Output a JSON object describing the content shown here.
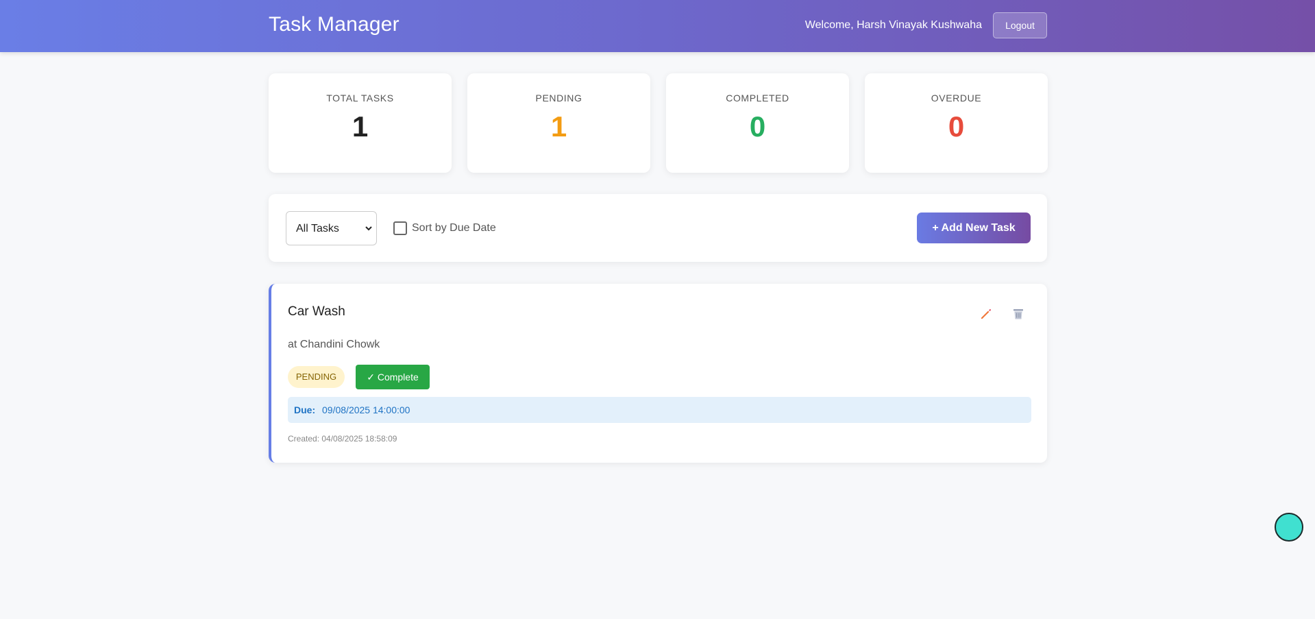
{
  "header": {
    "title": "Task Manager",
    "welcome": "Welcome, Harsh Vinayak Kushwaha",
    "logout_label": "Logout"
  },
  "stats": [
    {
      "label": "TOTAL TASKS",
      "value": "1",
      "color": "#222222"
    },
    {
      "label": "PENDING",
      "value": "1",
      "color": "#f39c12"
    },
    {
      "label": "COMPLETED",
      "value": "0",
      "color": "#27ae60"
    },
    {
      "label": "OVERDUE",
      "value": "0",
      "color": "#e74c3c"
    }
  ],
  "toolbar": {
    "filter_selected": "All Tasks",
    "sort_label": "Sort by Due Date",
    "sort_checked": false,
    "add_label": "+ Add New Task"
  },
  "task": {
    "title": "Car Wash",
    "description": "at Chandini Chowk",
    "status": "PENDING",
    "complete_label": "✓ Complete",
    "due_label": "Due:",
    "due_value": "09/08/2025 14:00:00",
    "created": "Created: 04/08/2025 18:58:09",
    "edit_icon": "pencil-icon",
    "delete_icon": "trash-icon"
  },
  "colors": {
    "accent": "#667eea",
    "accent_end": "#764ba2",
    "complete": "#28a745",
    "help_bubble": "#40e0d0"
  }
}
